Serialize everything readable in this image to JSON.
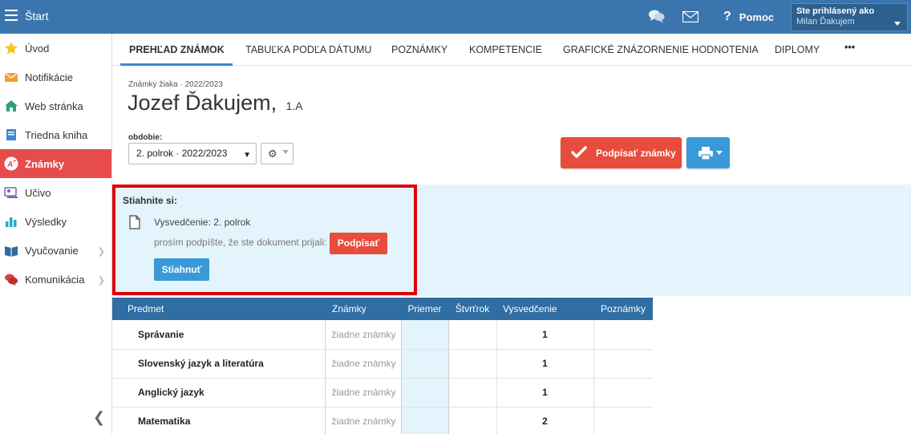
{
  "topbar": {
    "title": "Štart",
    "help_label": "Pomoc",
    "user_label": "Ste prihlásený ako",
    "user_name": "Milan Ďakujem",
    "bar_color": "#3a76ad"
  },
  "sidebar": {
    "items": [
      {
        "label": "Úvod",
        "icon": "star-icon"
      },
      {
        "label": "Notifikácie",
        "icon": "mail-icon"
      },
      {
        "label": "Web stránka",
        "icon": "home-icon"
      },
      {
        "label": "Triedna kniha",
        "icon": "book-icon"
      },
      {
        "label": "Známky",
        "icon": "grades-icon",
        "active": true
      },
      {
        "label": "Učivo",
        "icon": "curriculum-icon"
      },
      {
        "label": "Výsledky",
        "icon": "chart-icon"
      },
      {
        "label": "Vyučovanie",
        "icon": "open-book-icon"
      },
      {
        "label": "Komunikácia",
        "icon": "chat-icon"
      }
    ],
    "active_color": "#e74c4c"
  },
  "tabs": [
    {
      "label": "PREHĽAD ZNÁMOK",
      "active": true
    },
    {
      "label": "TABUĽKA PODĽA DÁTUMU"
    },
    {
      "label": "POZNÁMKY"
    },
    {
      "label": "KOMPETENCIE"
    },
    {
      "label": "GRAFICKÉ ZNÁZORNENIE HODNOTENIA"
    },
    {
      "label": "DIPLOMY"
    },
    {
      "label": "•••"
    }
  ],
  "header": {
    "subtitle": "Známky žiaka · 2022/2023",
    "student_name": "Jozef Ďakujem,",
    "class": "1.A",
    "period_label": "obdobie:",
    "period_value": "2. polrok · 2022/2023",
    "sign_button": "Podpísať známky"
  },
  "download": {
    "title": "Stiahnite si:",
    "doc_name": "Vysvedčenie: 2. polrok",
    "note": "prosím podpíšte, že ste dokument prijali:",
    "sign_label": "Podpísať",
    "download_label": "Stiahnuť"
  },
  "table": {
    "headers": [
      "Predmet",
      "Známky",
      "Priemer",
      "Štvrťrok",
      "Vysvedčenie",
      "Poznámky"
    ],
    "rows": [
      {
        "subject": "Správanie",
        "marks": "žiadne známky",
        "avg": "",
        "quarter": "",
        "final": "1",
        "notes": ""
      },
      {
        "subject": "Slovenský jazyk a literatúra",
        "marks": "žiadne známky",
        "avg": "",
        "quarter": "",
        "final": "1",
        "notes": ""
      },
      {
        "subject": "Anglický jazyk",
        "marks": "žiadne známky",
        "avg": "",
        "quarter": "",
        "final": "1",
        "notes": ""
      },
      {
        "subject": "Matematika",
        "marks": "žiadne známky",
        "avg": "",
        "quarter": "",
        "final": "2",
        "notes": ""
      }
    ]
  }
}
